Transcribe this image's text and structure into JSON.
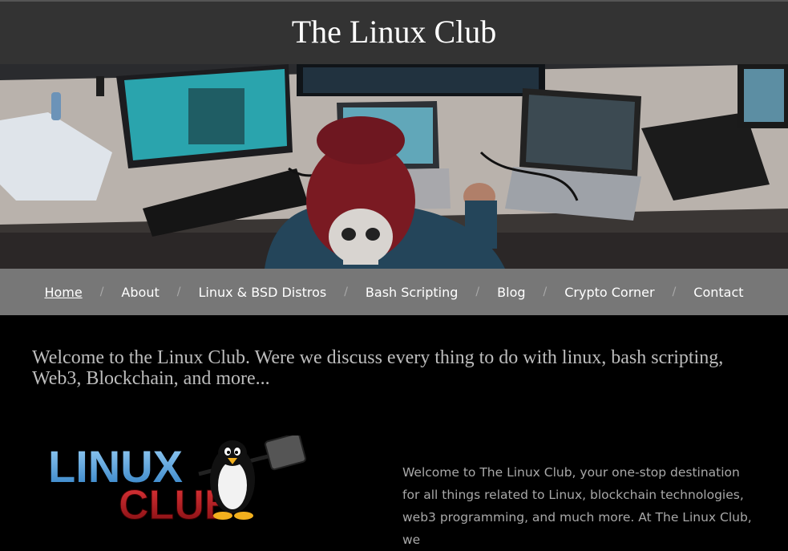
{
  "site": {
    "title": "The Linux Club"
  },
  "hero": {
    "image": "hacker-workstation-photo"
  },
  "nav": {
    "items": [
      {
        "label": "Home",
        "active": true
      },
      {
        "label": "About"
      },
      {
        "label": "Linux & BSD Distros"
      },
      {
        "label": "Bash Scripting"
      },
      {
        "label": "Blog"
      },
      {
        "label": "Crypto Corner"
      },
      {
        "label": "Contact"
      }
    ],
    "separator": "/"
  },
  "main": {
    "heading": "Welcome to the Linux Club. Were we discuss every thing to do with linux, bash scripting, Web3, Blockchain, and more...",
    "logo": {
      "line1": "LINUX",
      "line2": "CLUB",
      "icon": "tux-penguin-hammer-icon"
    },
    "intro": "Welcome to The Linux Club, your one-stop destination for all things related to Linux, blockchain technologies, web3 programming, and much more. At The Linux Club, we"
  },
  "colors": {
    "header_bg": "#333333",
    "nav_bg": "#777777",
    "body_bg": "#000000",
    "logo_blue": "#5aa9e6",
    "logo_red": "#c4161c"
  }
}
